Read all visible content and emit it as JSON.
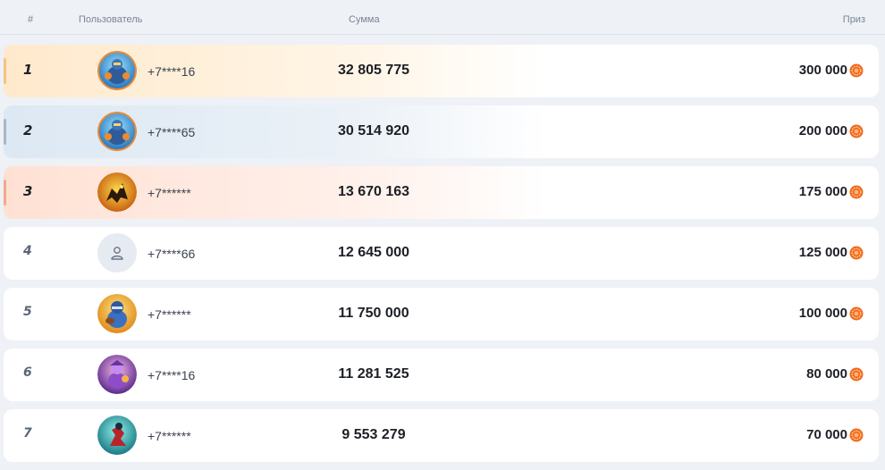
{
  "header": {
    "rank": "#",
    "user": "Пользователь",
    "sum": "Сумма",
    "prize": "Приз"
  },
  "colors": {
    "gold": "#f7c27f",
    "silver": "#a8b8c8",
    "bronze": "#f3a98c",
    "coin": "#f26a1b"
  },
  "rows": [
    {
      "rank": "1",
      "phone": "+7****16",
      "amount": "32 805 775",
      "prize": "300 000",
      "avatar": "blue-warrior-avatar"
    },
    {
      "rank": "2",
      "phone": "+7****65",
      "amount": "30 514 920",
      "prize": "200 000",
      "avatar": "blue-warrior-avatar"
    },
    {
      "rank": "3",
      "phone": "+7******",
      "amount": "13 670 163",
      "prize": "175 000",
      "avatar": "yellow-beast-avatar"
    },
    {
      "rank": "4",
      "phone": "+7****66",
      "amount": "12 645 000",
      "prize": "125 000",
      "avatar": "user-icon"
    },
    {
      "rank": "5",
      "phone": "+7******",
      "amount": "11 750 000",
      "prize": "100 000",
      "avatar": "football-player-avatar"
    },
    {
      "rank": "6",
      "phone": "+7****16",
      "amount": "11 281 525",
      "prize": "80 000",
      "avatar": "purple-hero-avatar"
    },
    {
      "rank": "7",
      "phone": "+7******",
      "amount": "9 553 279",
      "prize": "70 000",
      "avatar": "red-runner-avatar"
    }
  ]
}
